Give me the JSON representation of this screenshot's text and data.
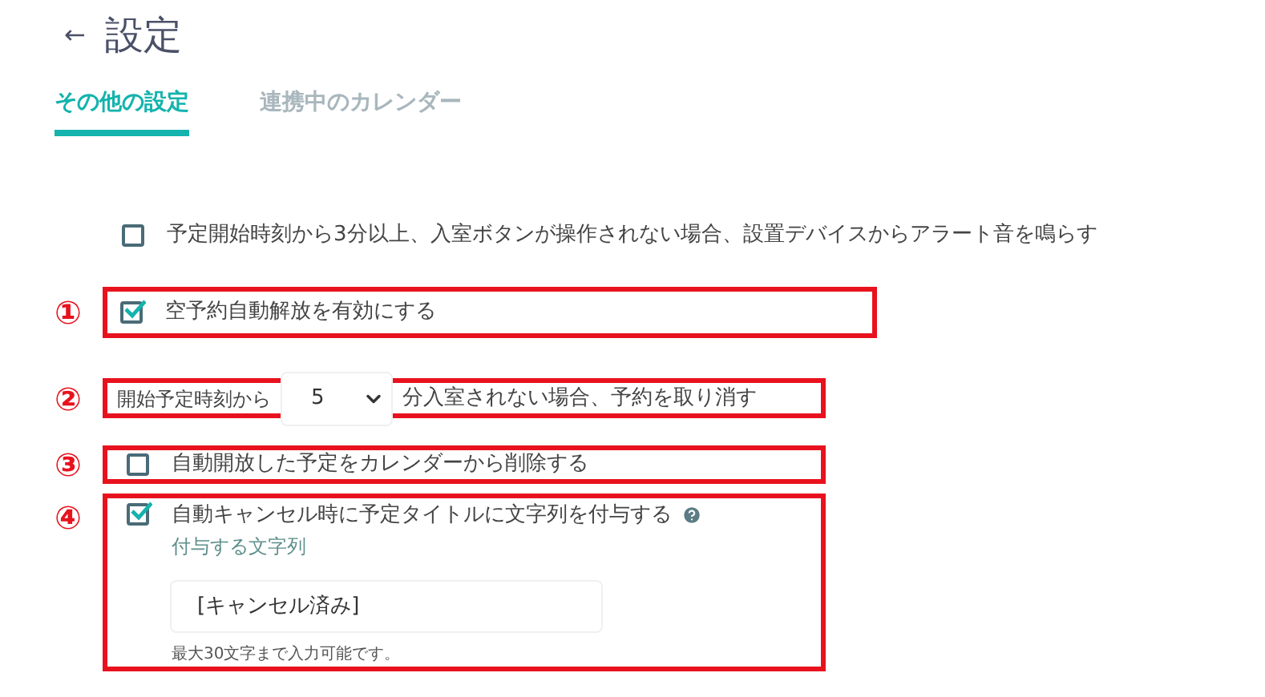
{
  "header": {
    "back": "←",
    "title": "設定"
  },
  "tabs": [
    {
      "label": "その他の設定",
      "selected": true
    },
    {
      "label": "連携中のカレンダー",
      "selected": false
    }
  ],
  "settings": [
    {
      "kind": "checkbox",
      "label": "予定開始時刻から3分以上、入室ボタンが操作されない場合、設置デバイスからアラート音を鳴らす",
      "checked": false
    },
    {
      "kind": "checkbox",
      "marker": "①",
      "label": "空予約自動解放を有効にする",
      "checked": true
    },
    {
      "kind": "select",
      "marker": "②",
      "prefix": "開始予定時刻から",
      "value": "5",
      "suffix": "分入室されない場合、予約を取り消す"
    },
    {
      "kind": "checkbox",
      "marker": "③",
      "label": "自動開放した予定をカレンダーから削除する",
      "checked": false
    },
    {
      "kind": "checkbox_text",
      "marker": "④",
      "label": "自動キャンセル時に予定タイトルに文字列を付与する",
      "checked": true,
      "field_label": "付与する文字列",
      "value": "[キャンセル済み]",
      "hint": "最大30文字まで入力可能です。"
    }
  ]
}
